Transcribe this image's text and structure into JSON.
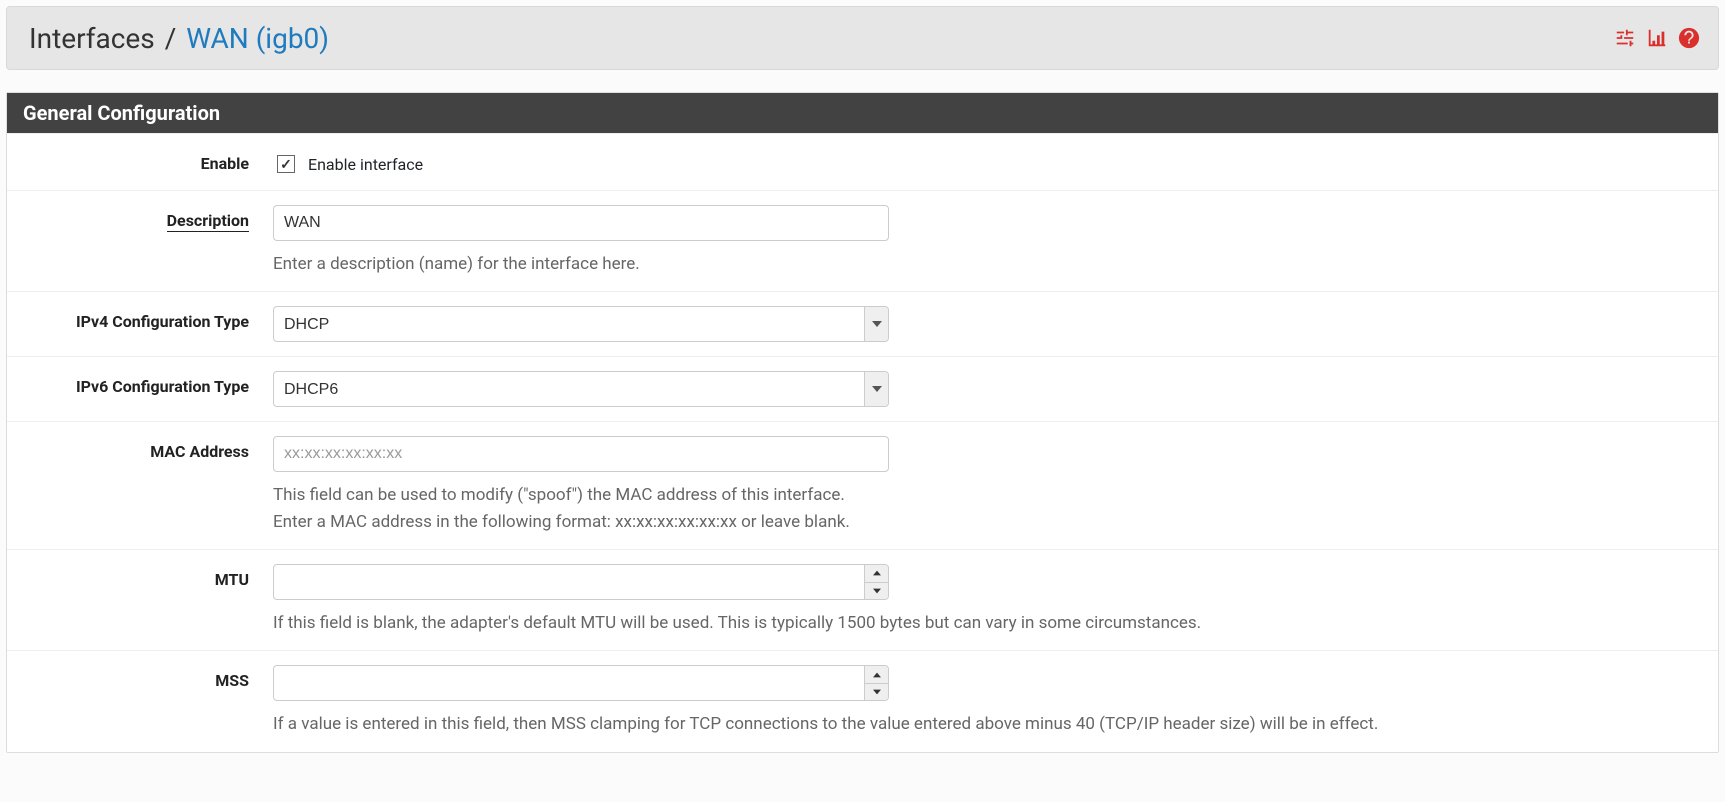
{
  "breadcrumb": {
    "root": "Interfaces",
    "leaf": "WAN (igb0)"
  },
  "panel": {
    "title": "General Configuration"
  },
  "fields": {
    "enable": {
      "label": "Enable",
      "checkbox_label": "Enable interface",
      "checked": true
    },
    "description": {
      "label": "Description",
      "value": "WAN",
      "help": "Enter a description (name) for the interface here."
    },
    "ipv4": {
      "label": "IPv4 Configuration Type",
      "value": "DHCP"
    },
    "ipv6": {
      "label": "IPv6 Configuration Type",
      "value": "DHCP6"
    },
    "mac": {
      "label": "MAC Address",
      "placeholder": "xx:xx:xx:xx:xx:xx",
      "value": "",
      "help_line1": "This field can be used to modify (\"spoof\") the MAC address of this interface.",
      "help_line2": "Enter a MAC address in the following format: xx:xx:xx:xx:xx:xx or leave blank."
    },
    "mtu": {
      "label": "MTU",
      "value": "",
      "help": "If this field is blank, the adapter's default MTU will be used. This is typically 1500 bytes but can vary in some circumstances."
    },
    "mss": {
      "label": "MSS",
      "value": "",
      "help": "If a value is entered in this field, then MSS clamping for TCP connections to the value entered above minus 40 (TCP/IP header size) will be in effect."
    }
  }
}
